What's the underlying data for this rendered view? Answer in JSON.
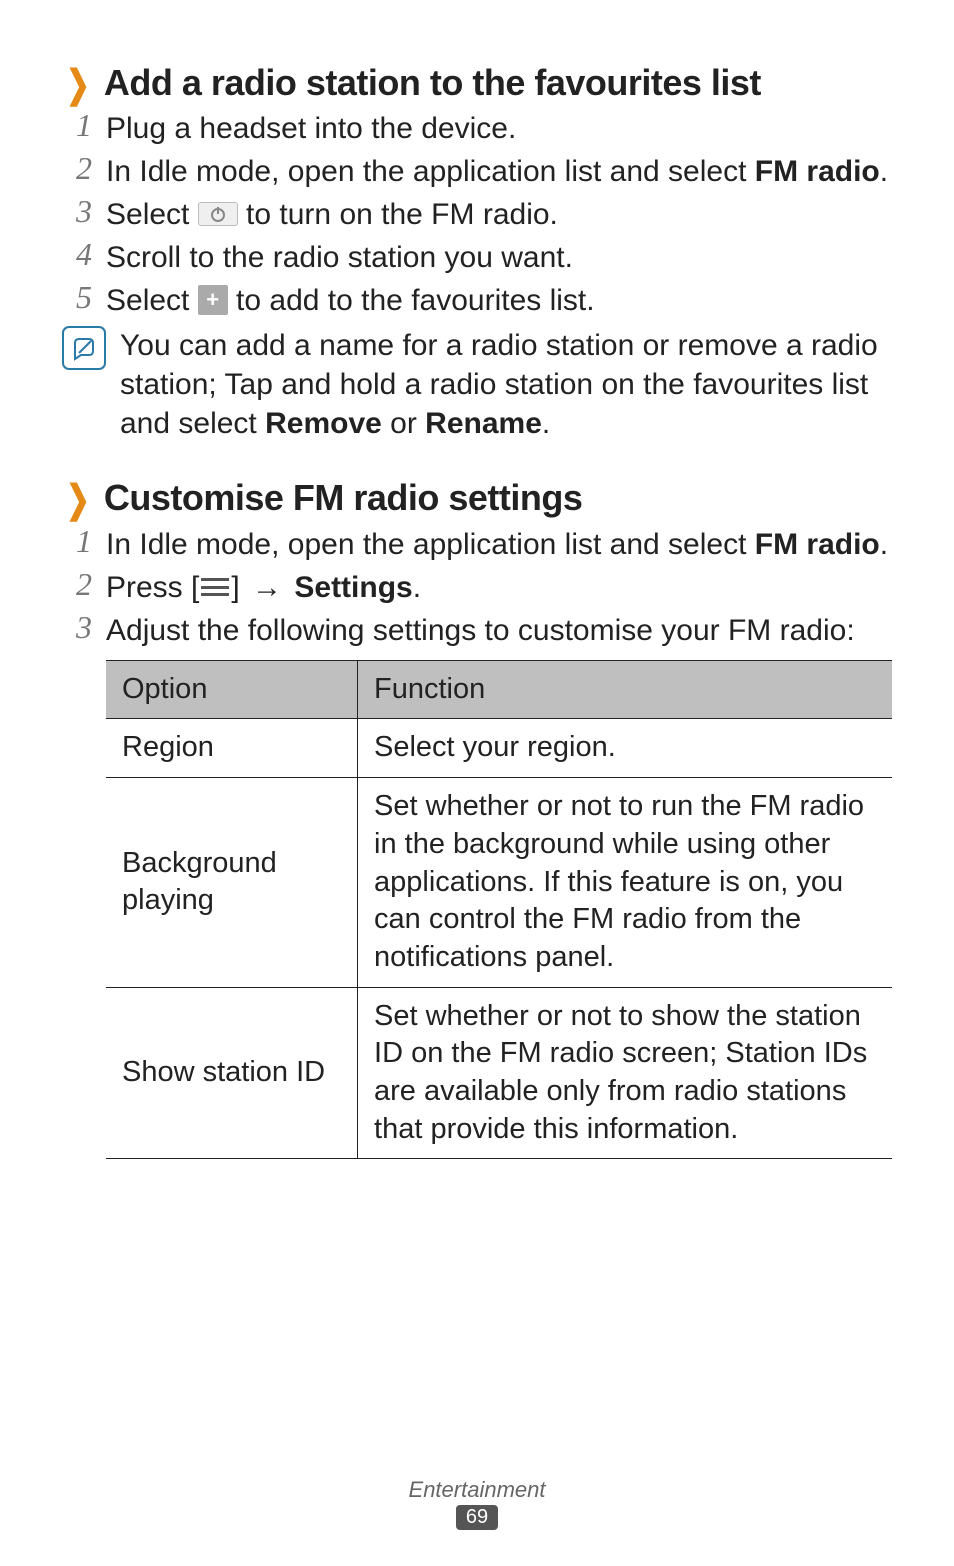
{
  "section1": {
    "title": "Add a radio station to the favourites list",
    "items": {
      "i1": "Plug a headset into the device.",
      "i2_a": "In Idle mode, open the application list and select ",
      "i2_b": "FM radio",
      "i2_c": ".",
      "i3_a": "Select ",
      "i3_b": " to turn on the FM radio.",
      "i4": "Scroll to the radio station you want.",
      "i5_a": "Select ",
      "i5_b": " to add to the favourites list."
    },
    "note_a": "You can add a name for a radio station or remove a radio station; Tap and hold a radio station on the favourites list and select ",
    "note_b": "Remove",
    "note_c": " or ",
    "note_d": "Rename",
    "note_e": "."
  },
  "section2": {
    "title": "Customise FM radio settings",
    "items": {
      "i1_a": "In Idle mode, open the application list and select ",
      "i1_b": "FM radio",
      "i1_c": ".",
      "i2_a": "Press [",
      "i2_b": "] ",
      "arrow": "→",
      "i2_c": " ",
      "i2_d": "Settings",
      "i2_e": ".",
      "i3": "Adjust the following settings to customise your FM radio:"
    },
    "table": {
      "h1": "Option",
      "h2": "Function",
      "r1c1": "Region",
      "r1c2": "Select your region.",
      "r2c1": "Background playing",
      "r2c2": "Set whether or not to run the FM radio in the background while using other applications. If this feature is on, you can control the FM radio from the notifications panel.",
      "r3c1": "Show station ID",
      "r3c2": "Set whether or not to show the station ID on the FM radio screen; Station IDs are available only from radio stations that provide this information."
    }
  },
  "nums": {
    "n1": "1",
    "n2": "2",
    "n3": "3",
    "n4": "4",
    "n5": "5"
  },
  "footer": {
    "category": "Entertainment",
    "page": "69"
  }
}
